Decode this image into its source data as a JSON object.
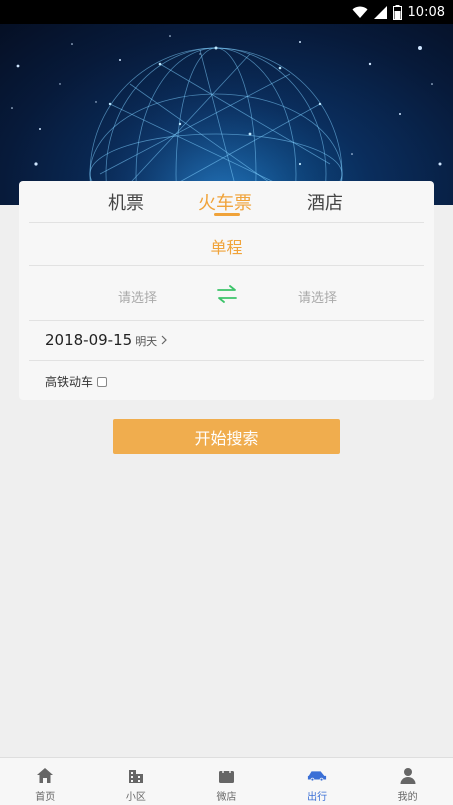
{
  "status_bar": {
    "time": "10:08"
  },
  "tabs": [
    {
      "label": "机票",
      "active": false
    },
    {
      "label": "火车票",
      "active": true
    },
    {
      "label": "酒店",
      "active": false
    }
  ],
  "trip_type": "单程",
  "from_station": {
    "placeholder": "请选择"
  },
  "to_station": {
    "placeholder": "请选择"
  },
  "date": {
    "value": "2018-09-15",
    "day_label": "明天"
  },
  "high_speed": {
    "label": "高铁动车",
    "checked": false
  },
  "search_button": {
    "label": "开始搜索"
  },
  "bottom_nav": [
    {
      "label": "首页",
      "icon": "home-icon",
      "active": false
    },
    {
      "label": "小区",
      "icon": "building-icon",
      "active": false
    },
    {
      "label": "微店",
      "icon": "shopping-bag-icon",
      "active": false
    },
    {
      "label": "出行",
      "icon": "car-icon",
      "active": true
    },
    {
      "label": "我的",
      "icon": "user-icon",
      "active": false
    }
  ],
  "colors": {
    "accent": "#f0a33a",
    "button": "#f0ad4e",
    "swap": "#3cc46a",
    "nav_active": "#3a6fd6",
    "background": "#efefef"
  }
}
